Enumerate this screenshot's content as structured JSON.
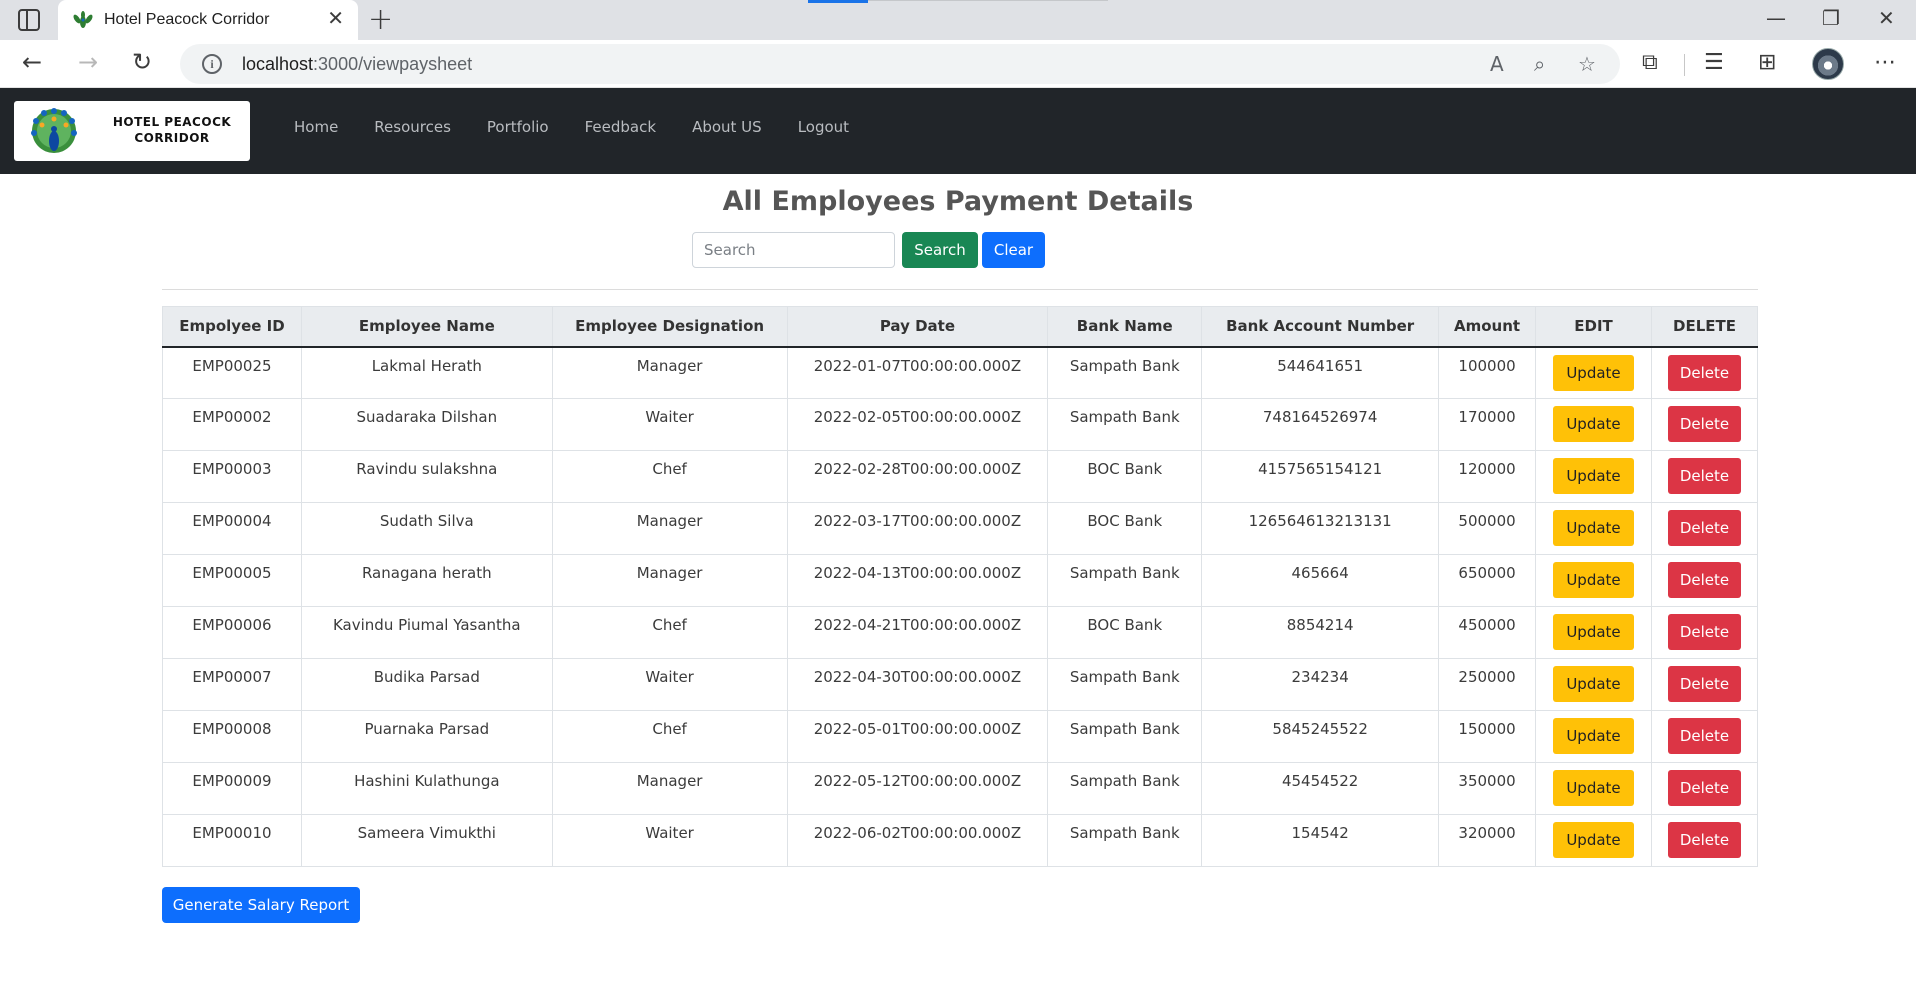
{
  "browser": {
    "tab_title": "Hotel Peacock Corridor",
    "tab_close": "✕",
    "new_tab": "+",
    "url_host": "localhost",
    "url_path": ":3000/viewpaysheet",
    "window_controls": {
      "minimize": "—",
      "restore": "❐",
      "close": "✕"
    },
    "icons": [
      "back-icon",
      "forward-icon",
      "refresh-icon",
      "info-icon",
      "read-aloud-icon",
      "zoom-icon",
      "add-favorite-icon",
      "extensions-icon",
      "favorites-icon",
      "collections-icon",
      "profile-avatar",
      "more-menu-icon"
    ]
  },
  "app": {
    "brand_line1": "HOTEL PEACOCK",
    "brand_line2": "CORRIDOR",
    "nav": [
      "Home",
      "Resources",
      "Portfolio",
      "Feedback",
      "About US",
      "Logout"
    ]
  },
  "page": {
    "title": "All Employees Payment Details",
    "search_placeholder": "Search",
    "search_button": "Search",
    "clear_button": "Clear",
    "report_button": "Generate Salary Report"
  },
  "table": {
    "headers": [
      "Empolyee ID",
      "Employee Name",
      "Employee Designation",
      "Pay Date",
      "Bank Name",
      "Bank Account Number",
      "Amount",
      "EDIT",
      "DELETE"
    ],
    "update_label": "Update",
    "delete_label": "Delete",
    "rows": [
      [
        "EMP00025",
        "Lakmal Herath",
        "Manager",
        "2022-01-07T00:00:00.000Z",
        "Sampath Bank",
        "544641651",
        "100000"
      ],
      [
        "EMP00002",
        "Suadaraka Dilshan",
        "Waiter",
        "2022-02-05T00:00:00.000Z",
        "Sampath Bank",
        "748164526974",
        "170000"
      ],
      [
        "EMP00003",
        "Ravindu sulakshna",
        "Chef",
        "2022-02-28T00:00:00.000Z",
        "BOC Bank",
        "4157565154121",
        "120000"
      ],
      [
        "EMP00004",
        "Sudath Silva",
        "Manager",
        "2022-03-17T00:00:00.000Z",
        "BOC Bank",
        "126564613213131",
        "500000"
      ],
      [
        "EMP00005",
        "Ranagana herath",
        "Manager",
        "2022-04-13T00:00:00.000Z",
        "Sampath Bank",
        "465664",
        "650000"
      ],
      [
        "EMP00006",
        "Kavindu Piumal Yasantha",
        "Chef",
        "2022-04-21T00:00:00.000Z",
        "BOC Bank",
        "8854214",
        "450000"
      ],
      [
        "EMP00007",
        "Budika Parsad",
        "Waiter",
        "2022-04-30T00:00:00.000Z",
        "Sampath Bank",
        "234234",
        "250000"
      ],
      [
        "EMP00008",
        "Puarnaka Parsad",
        "Chef",
        "2022-05-01T00:00:00.000Z",
        "Sampath Bank",
        "5845245522",
        "150000"
      ],
      [
        "EMP00009",
        "Hashini Kulathunga",
        "Manager",
        "2022-05-12T00:00:00.000Z",
        "Sampath Bank",
        "45454522",
        "350000"
      ],
      [
        "EMP00010",
        "Sameera Vimukthi",
        "Waiter",
        "2022-06-02T00:00:00.000Z",
        "Sampath Bank",
        "154542",
        "320000"
      ]
    ]
  },
  "colors": {
    "navbar": "#212529",
    "search_button": "#198754",
    "primary": "#0d6efd",
    "update": "#ffc107",
    "delete": "#dc3545"
  }
}
